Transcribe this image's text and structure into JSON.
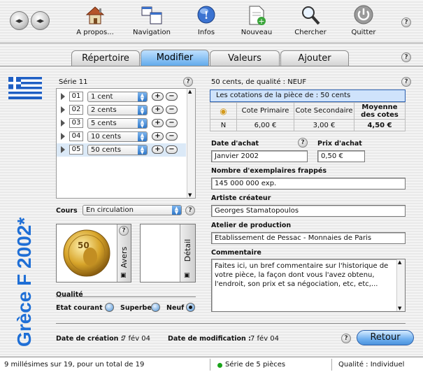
{
  "toolbar": {
    "items": [
      {
        "label": "A propos...",
        "icon": "house-icon"
      },
      {
        "label": "Navigation",
        "icon": "windows-icon"
      },
      {
        "label": "Infos",
        "icon": "info-icon"
      },
      {
        "label": "Nouveau",
        "icon": "new-document-icon"
      },
      {
        "label": "Chercher",
        "icon": "magnifier-icon"
      },
      {
        "label": "Quitter",
        "icon": "power-icon"
      }
    ]
  },
  "tabs": [
    "Répertoire",
    "Modifier",
    "Valeurs",
    "Ajouter"
  ],
  "active_tab": "Modifier",
  "side_title": "Grèce F 2002*",
  "series": {
    "title": "Série 11",
    "rows": [
      {
        "num": "01",
        "value": "1 cent"
      },
      {
        "num": "02",
        "value": "2 cents"
      },
      {
        "num": "03",
        "value": "5 cents"
      },
      {
        "num": "04",
        "value": "10 cents"
      },
      {
        "num": "05",
        "value": "50 cents"
      }
    ]
  },
  "cours": {
    "label": "Cours",
    "value": "En circulation"
  },
  "images": {
    "avers": "Avers",
    "detail": "Détail"
  },
  "qualite": {
    "title": "Qualité",
    "options": [
      "Etat courant",
      "Superbe",
      "Neuf"
    ],
    "selected": "Neuf"
  },
  "piece": {
    "heading": "50 cents, de qualité : NEUF",
    "cotations_title": "Les cotations de la pièce de : 50 cents",
    "col1": "Cote Primaire",
    "col2": "Cote Secondaire",
    "col3": "Moyenne des cotes",
    "row_label": "N",
    "cote_primaire": "6,00 €",
    "cote_secondaire": "3,00 €",
    "moyenne": "4,50 €"
  },
  "fields": {
    "date_achat_label": "Date d'achat",
    "date_achat": "Janvier 2002",
    "prix_achat_label": "Prix d'achat",
    "prix_achat": "0,50 €",
    "exemplaires_label": "Nombre d'exemplaires frappés",
    "exemplaires": "145 000 000 exp.",
    "artiste_label": "Artiste créateur",
    "artiste": "Georges Stamatopoulos",
    "atelier_label": "Atelier de production",
    "atelier": "Etablissement de Pessac - Monnaies de Paris",
    "commentaire_label": "Commentaire",
    "commentaire": "Faites ici, un bref commentaire sur l'historique de votre pièce, la façon dont vous l'avez obtenu, l'endroit, son prix et sa négociation, etc, etc,..."
  },
  "dates": {
    "creation_label": "Date de création :",
    "creation": "7 fév 04",
    "modification_label": "Date de modification :",
    "modification": "7 fév 04"
  },
  "retour_label": "Retour",
  "status": {
    "left": "9 millésimes sur 19, pour un total de 19",
    "middle": "Série de 5 pièces",
    "right": "Qualité : Individuel"
  },
  "colors": {
    "accent": "#2a7ad2",
    "vertical_title": "#1f6fd6",
    "status_dot": "#1aa31a"
  }
}
